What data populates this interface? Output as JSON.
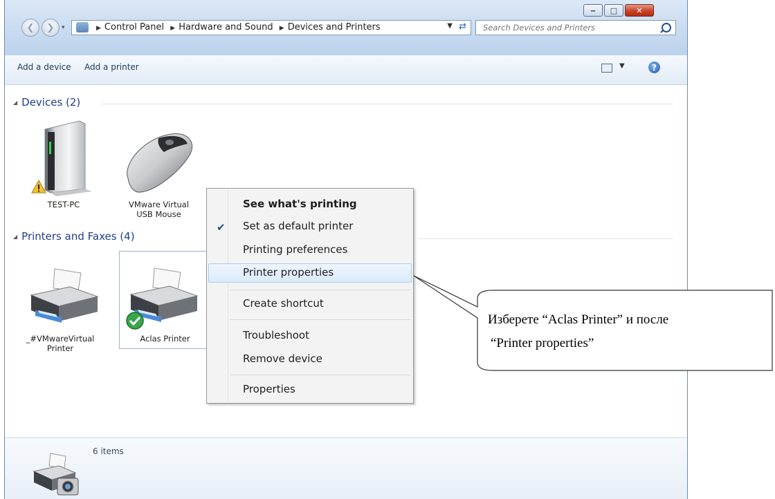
{
  "address": {
    "crumbs": [
      "Control Panel",
      "Hardware and Sound",
      "Devices and Printers"
    ]
  },
  "search": {
    "placeholder": "Search Devices and Printers"
  },
  "toolbar": {
    "add_device": "Add a device",
    "add_printer": "Add a printer"
  },
  "groups": {
    "devices": "Devices (2)",
    "printers": "Printers and Faxes (4)"
  },
  "devices": [
    {
      "label_line1": "TEST-PC",
      "label_line2": ""
    },
    {
      "label_line1": "VMware Virtual",
      "label_line2": "USB Mouse"
    }
  ],
  "printers": [
    {
      "label_line1": "_#VMwareVirtual",
      "label_line2": "Printer"
    },
    {
      "label_line1": "Aclas Printer",
      "label_line2": ""
    }
  ],
  "context_menu": {
    "items": [
      {
        "label": "See what's printing",
        "bold": true
      },
      {
        "label": "Set as default printer",
        "checked": true
      },
      {
        "label": "Printing preferences"
      },
      {
        "label": "Printer properties",
        "highlighted": true
      },
      {
        "label": "Create shortcut"
      },
      {
        "label": "Troubleshoot"
      },
      {
        "label": "Remove device"
      },
      {
        "label": "Properties"
      }
    ]
  },
  "status": {
    "count": "6 items"
  },
  "callout": {
    "line1": "Изберете “Aclas Printer” и после",
    "line2": "“Printer properties”"
  }
}
